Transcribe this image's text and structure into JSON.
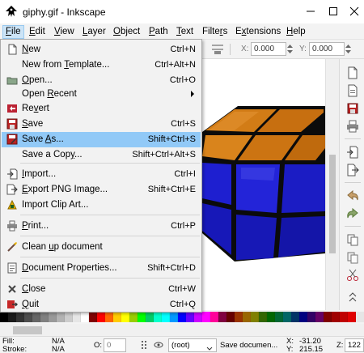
{
  "window": {
    "title": "giphy.gif - Inkscape",
    "minimize_label": "minimize",
    "maximize_label": "maximize",
    "close_label": "close"
  },
  "menubar": {
    "items": [
      {
        "label": "File",
        "key": "F",
        "rest": "ile"
      },
      {
        "label": "Edit",
        "key": "E",
        "rest": "dit"
      },
      {
        "label": "View",
        "key": "V",
        "rest": "iew"
      },
      {
        "label": "Layer",
        "key": "L",
        "rest": "ayer"
      },
      {
        "label": "Object",
        "key": "O",
        "rest": "bject"
      },
      {
        "label": "Path",
        "key": "P",
        "rest": "ath"
      },
      {
        "label": "Text",
        "key": "T",
        "rest": "ext"
      },
      {
        "label": "Filters",
        "pre": "Filte",
        "key": "r",
        "rest": "s"
      },
      {
        "label": "Extensions",
        "pre": "E",
        "key": "x",
        "rest": "tensions"
      },
      {
        "label": "Help",
        "key": "H",
        "rest": "elp"
      }
    ]
  },
  "toolbar": {
    "x_label": "X:",
    "x_value": "0.000",
    "y_label": "Y:",
    "y_value": "0.000"
  },
  "file_menu": {
    "items": [
      {
        "pre": "",
        "key": "N",
        "rest": "ew",
        "shortcut": "Ctrl+N",
        "icon": "new-document-icon"
      },
      {
        "pre": "New from ",
        "key": "T",
        "rest": "emplate...",
        "shortcut": "Ctrl+Alt+N",
        "icon": "none"
      },
      {
        "pre": "",
        "key": "O",
        "rest": "pen...",
        "shortcut": "Ctrl+O",
        "icon": "open-folder-icon"
      },
      {
        "pre": "Open ",
        "key": "R",
        "rest": "ecent",
        "shortcut": "",
        "icon": "none",
        "submenu": true
      },
      {
        "pre": "Re",
        "key": "v",
        "rest": "ert",
        "shortcut": "",
        "icon": "revert-icon"
      },
      {
        "pre": "",
        "key": "S",
        "rest": "ave",
        "shortcut": "Ctrl+S",
        "icon": "save-icon"
      },
      {
        "pre": "Save ",
        "key": "A",
        "rest": "s...",
        "shortcut": "Shift+Ctrl+S",
        "icon": "save-as-icon",
        "highlighted": true
      },
      {
        "pre": "Save a Cop",
        "key": "y",
        "rest": "...",
        "shortcut": "Shift+Ctrl+Alt+S",
        "icon": "none"
      },
      {
        "pre": "",
        "key": "I",
        "rest": "mport...",
        "shortcut": "Ctrl+I",
        "icon": "import-icon"
      },
      {
        "pre": "",
        "key": "E",
        "rest": "xport PNG Image...",
        "shortcut": "Shift+Ctrl+E",
        "icon": "export-png-icon"
      },
      {
        "pre": "Import Clip Art...",
        "key": "",
        "rest": "",
        "shortcut": "",
        "icon": "clip-art-icon"
      },
      {
        "pre": "",
        "key": "P",
        "rest": "rint...",
        "shortcut": "Ctrl+P",
        "icon": "print-icon"
      },
      {
        "pre": "Clean ",
        "key": "u",
        "rest": "p document",
        "shortcut": "",
        "icon": "clean-up-icon"
      },
      {
        "pre": "",
        "key": "D",
        "rest": "ocument Properties...",
        "shortcut": "Shift+Ctrl+D",
        "icon": "document-properties-icon"
      },
      {
        "pre": "",
        "key": "C",
        "rest": "lose",
        "shortcut": "Ctrl+W",
        "icon": "close-document-icon"
      },
      {
        "pre": "",
        "key": "Q",
        "rest": "uit",
        "shortcut": "Ctrl+Q",
        "icon": "quit-icon"
      }
    ]
  },
  "statusbar": {
    "fill_label": "Fill:",
    "fill_value": "N/A",
    "stroke_label": "Stroke:",
    "stroke_value": "N/A",
    "opacity_label": "O:",
    "opacity_value": "0",
    "layer_value": "(root)",
    "message": "Save documen...",
    "x_label": "X:",
    "x_value": "-31.20",
    "y_label": "Y:",
    "y_value": "215.15",
    "zoom_label": "Z:",
    "zoom_value": "122"
  },
  "palette": {
    "colors": [
      "#000000",
      "#1a1a1a",
      "#333333",
      "#4d4d4d",
      "#666666",
      "#808080",
      "#999999",
      "#b3b3b3",
      "#cccccc",
      "#e6e6e6",
      "#ffffff",
      "#800000",
      "#ff0000",
      "#ff6600",
      "#ffcc00",
      "#ffff00",
      "#99cc00",
      "#00ff00",
      "#00cc66",
      "#00ffcc",
      "#00ffff",
      "#0099ff",
      "#0000ff",
      "#6600ff",
      "#cc00ff",
      "#ff00ff",
      "#ff0099",
      "#800040",
      "#660000",
      "#993300",
      "#996600",
      "#808000",
      "#336600",
      "#006600",
      "#006633",
      "#006666",
      "#003366",
      "#000080",
      "#330066",
      "#660066",
      "#800000",
      "#a00000",
      "#c00000",
      "#e00000"
    ]
  },
  "colors": {
    "menu_highlight": "#91c9f7",
    "cube_top": "#d27c16",
    "cube_side": "#1d1ec8"
  }
}
